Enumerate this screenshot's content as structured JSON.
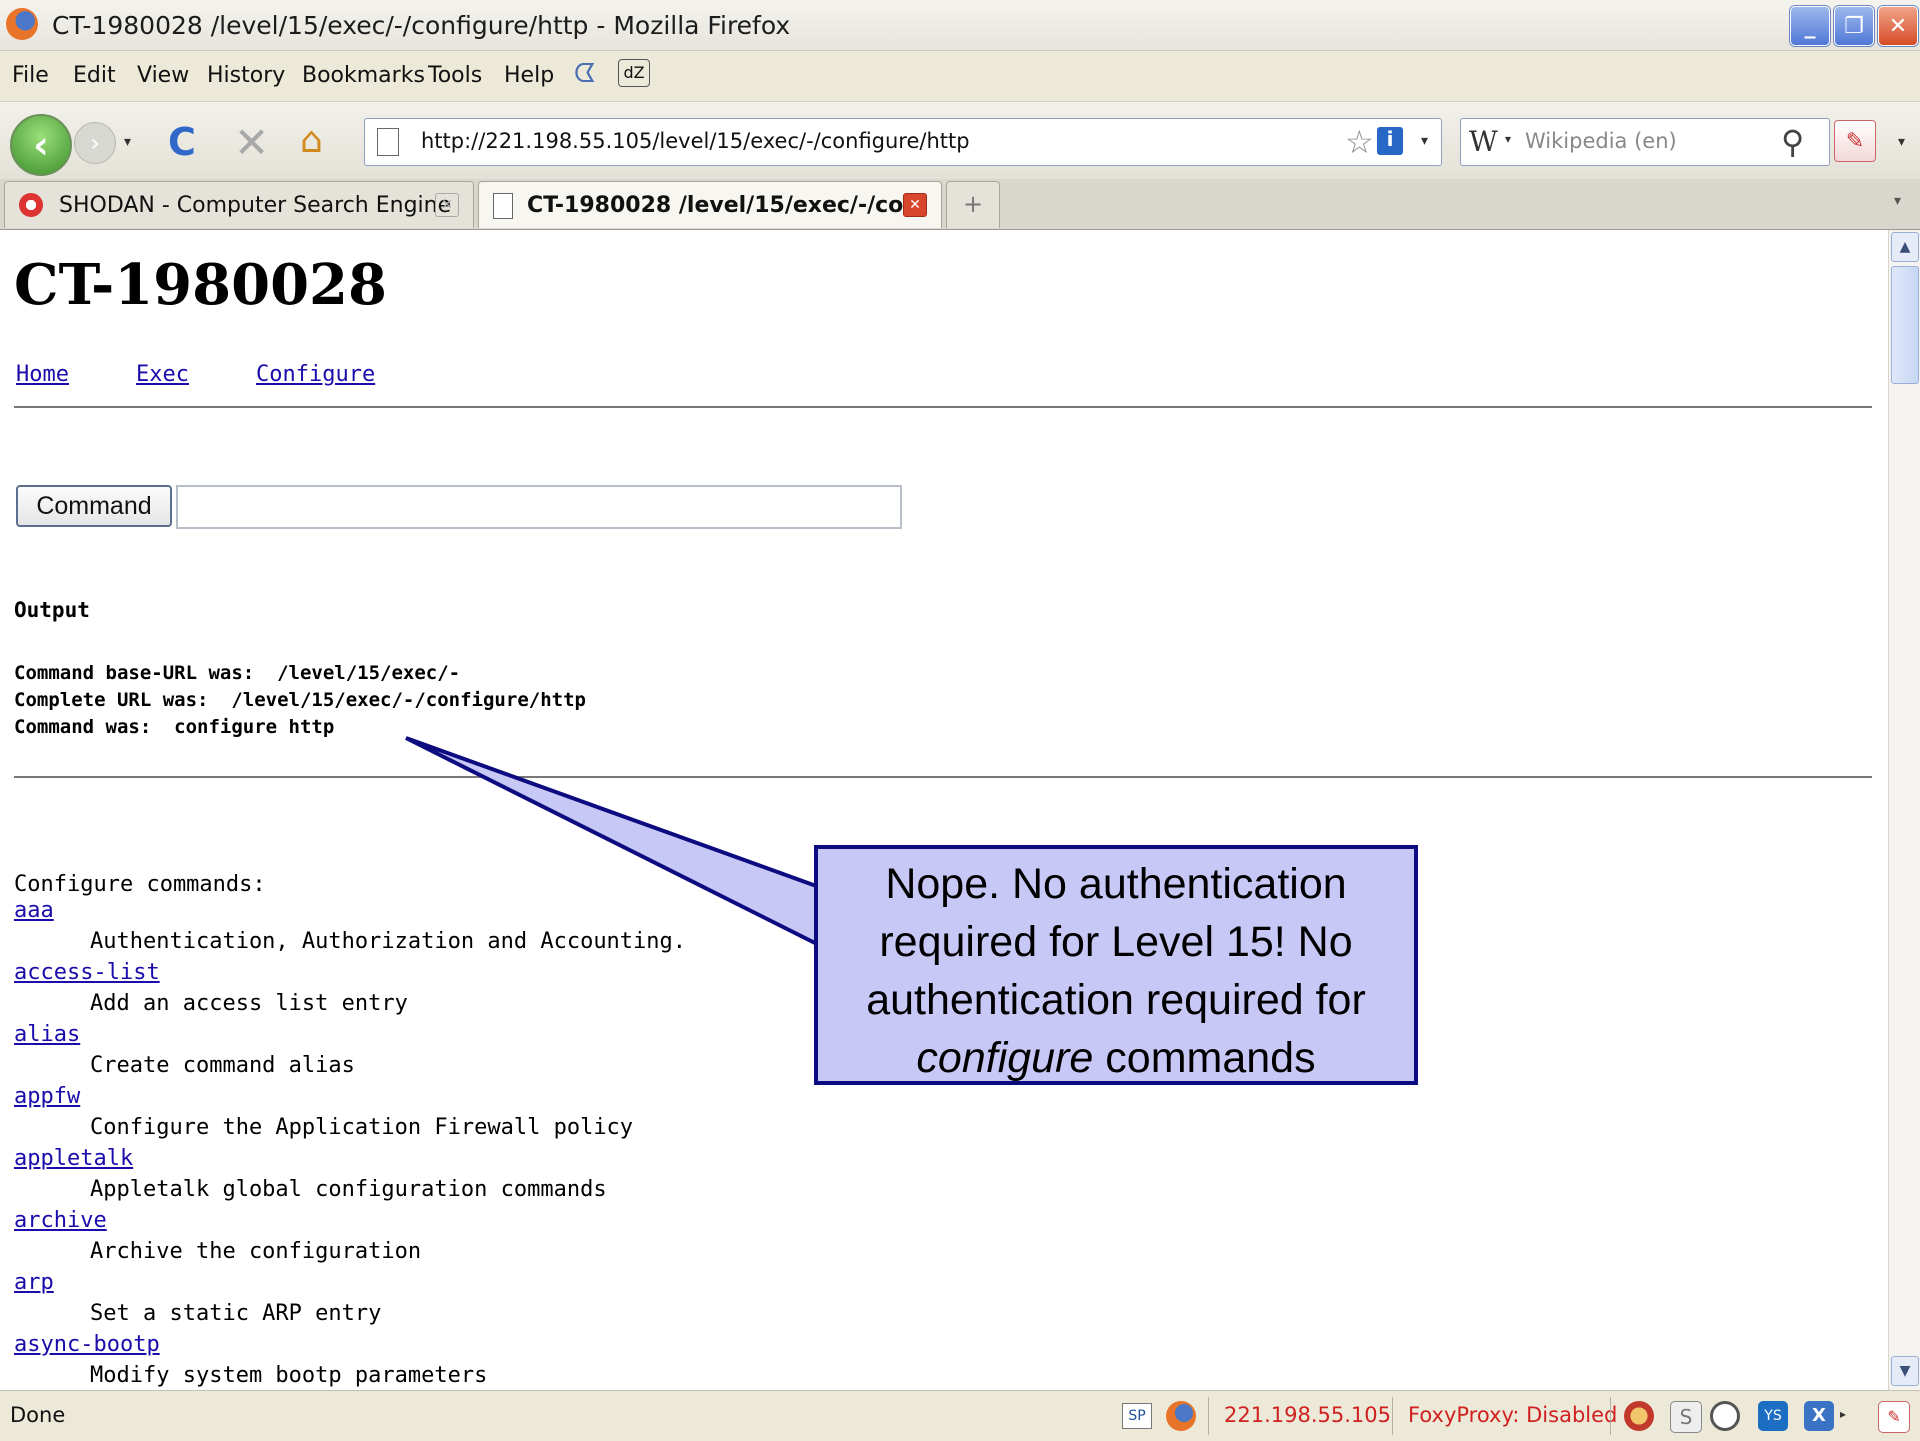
{
  "window": {
    "title": "CT-1980028 /level/15/exec/-/configure/http - Mozilla Firefox",
    "min_glyph": "_",
    "max_glyph": "❐",
    "close_glyph": "✕"
  },
  "menu": [
    "File",
    "Edit",
    "View",
    "History",
    "Bookmarks",
    "Tools",
    "Help"
  ],
  "menu_extra_icons": [
    "hare-icon",
    "dz-icon"
  ],
  "menu_extra_glyph": "ᗧ",
  "navbar": {
    "back_glyph": "‹",
    "forward_glyph": "›",
    "dropdown_glyph": "▾",
    "reload_glyph": "C",
    "stop_glyph": "✕",
    "home_glyph": "⌂",
    "url": "http://221.198.55.105/level/15/exec/-/configure/http",
    "bookmark_glyph": "☆",
    "info_glyph": "i",
    "search_engine_glyph": "W",
    "search_placeholder": "Wikipedia (en)",
    "search_glyph": "⚲",
    "extension_glyph": "✎"
  },
  "tabs": [
    {
      "label": "SHODAN - Computer Search Engine",
      "active": false
    },
    {
      "label": "CT-1980028 /level/15/exec/-/co...",
      "active": true
    }
  ],
  "tab_close_glyph": "✕",
  "new_tab_glyph": "+",
  "tab_list_glyph": "▾",
  "page": {
    "title": "CT-1980028",
    "nav_links": [
      "Home",
      "Exec",
      "Configure"
    ],
    "command_button": "Command",
    "command_input_value": "",
    "output_heading": "Output",
    "output_lines": [
      "Command base-URL was:  /level/15/exec/-",
      "Complete URL was:  /level/15/exec/-/configure/http",
      "Command was:  configure http"
    ],
    "configure_header": "Configure commands:",
    "commands": [
      {
        "name": "aaa",
        "desc": "Authentication, Authorization and Accounting."
      },
      {
        "name": "access-list",
        "desc": "Add an access list entry"
      },
      {
        "name": "alias",
        "desc": "Create command alias"
      },
      {
        "name": "appfw",
        "desc": "Configure the Application Firewall policy"
      },
      {
        "name": "appletalk",
        "desc": "Appletalk global configuration commands"
      },
      {
        "name": "archive",
        "desc": "Archive the configuration"
      },
      {
        "name": "arp",
        "desc": "Set a static ARP entry"
      },
      {
        "name": "async-bootp",
        "desc": "Modify system bootp parameters"
      }
    ]
  },
  "callout": {
    "line1": "Nope. No authentication",
    "line2": "required for Level 15!  No",
    "line3": "authentication required for",
    "line4_italic": "configure",
    "line4_rest": " commands",
    "fill_color": "#c8c8f6",
    "border_color": "#0c0c80"
  },
  "scrollbar": {
    "up_glyph": "▲",
    "down_glyph": "▼"
  },
  "status": {
    "text": "Done",
    "sp_label": "SP",
    "ip": "221.198.55.105",
    "proxy": "FoxyProxy: Disabled",
    "s_label": "S",
    "yslow_label": "YS",
    "x_label": "X",
    "x_drop_glyph": "▸",
    "ext_glyph": "✎",
    "accent_color": "#d02020"
  }
}
